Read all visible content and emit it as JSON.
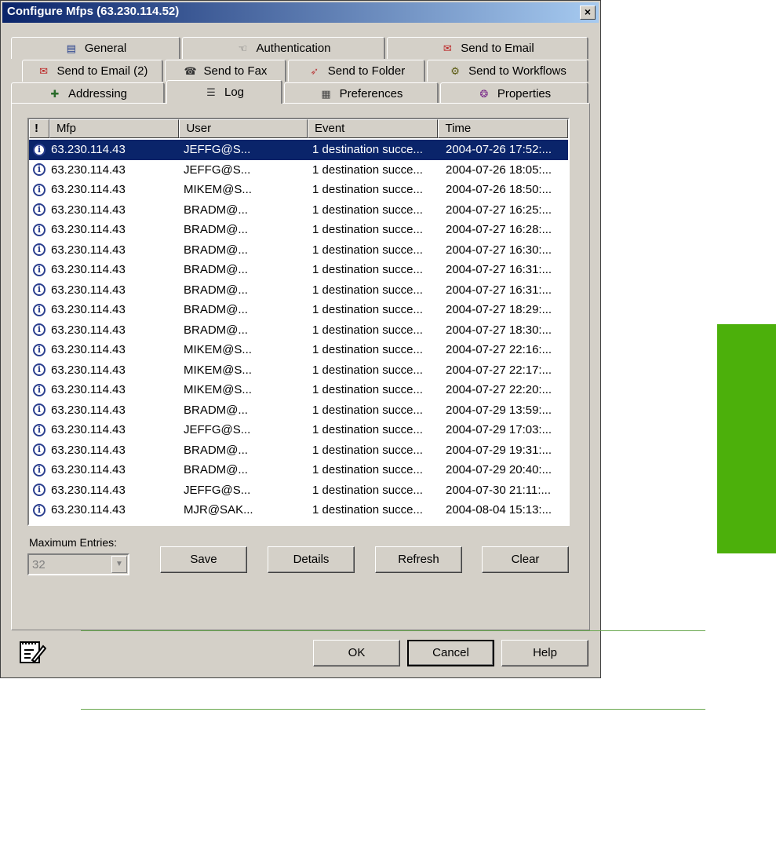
{
  "window": {
    "title": "Configure Mfps (63.230.114.52)",
    "close_label": "×"
  },
  "tabs": {
    "row1": [
      {
        "label": "General",
        "icon": "general-icon"
      },
      {
        "label": "Authentication",
        "icon": "authentication-icon"
      },
      {
        "label": "Send to Email",
        "icon": "send-email-icon"
      }
    ],
    "row2": [
      {
        "label": "Send to Email (2)",
        "icon": "send-email-2-icon"
      },
      {
        "label": "Send to Fax",
        "icon": "send-fax-icon"
      },
      {
        "label": "Send to Folder",
        "icon": "send-folder-icon"
      },
      {
        "label": "Send to Workflows",
        "icon": "send-workflows-icon"
      }
    ],
    "row3": [
      {
        "label": "Addressing",
        "icon": "addressing-icon"
      },
      {
        "label": "Log",
        "icon": "log-icon",
        "active": true
      },
      {
        "label": "Preferences",
        "icon": "preferences-icon"
      },
      {
        "label": "Properties",
        "icon": "properties-icon"
      }
    ]
  },
  "log": {
    "columns": [
      "!",
      "Mfp",
      "User",
      "Event",
      "Time"
    ],
    "rows": [
      {
        "mfp": "63.230.114.43",
        "user": "JEFFG@S...",
        "event": "1 destination succe...",
        "time": "2004-07-26 17:52:...",
        "selected": true
      },
      {
        "mfp": "63.230.114.43",
        "user": "JEFFG@S...",
        "event": "1 destination succe...",
        "time": "2004-07-26 18:05:..."
      },
      {
        "mfp": "63.230.114.43",
        "user": "MIKEM@S...",
        "event": "1 destination succe...",
        "time": "2004-07-26 18:50:..."
      },
      {
        "mfp": "63.230.114.43",
        "user": "BRADM@...",
        "event": "1 destination succe...",
        "time": "2004-07-27 16:25:..."
      },
      {
        "mfp": "63.230.114.43",
        "user": "BRADM@...",
        "event": "1 destination succe...",
        "time": "2004-07-27 16:28:..."
      },
      {
        "mfp": "63.230.114.43",
        "user": "BRADM@...",
        "event": "1 destination succe...",
        "time": "2004-07-27 16:30:..."
      },
      {
        "mfp": "63.230.114.43",
        "user": "BRADM@...",
        "event": "1 destination succe...",
        "time": "2004-07-27 16:31:..."
      },
      {
        "mfp": "63.230.114.43",
        "user": "BRADM@...",
        "event": "1 destination succe...",
        "time": "2004-07-27 16:31:..."
      },
      {
        "mfp": "63.230.114.43",
        "user": "BRADM@...",
        "event": "1 destination succe...",
        "time": "2004-07-27 18:29:..."
      },
      {
        "mfp": "63.230.114.43",
        "user": "BRADM@...",
        "event": "1 destination succe...",
        "time": "2004-07-27 18:30:..."
      },
      {
        "mfp": "63.230.114.43",
        "user": "MIKEM@S...",
        "event": "1 destination succe...",
        "time": "2004-07-27 22:16:..."
      },
      {
        "mfp": "63.230.114.43",
        "user": "MIKEM@S...",
        "event": "1 destination succe...",
        "time": "2004-07-27 22:17:..."
      },
      {
        "mfp": "63.230.114.43",
        "user": "MIKEM@S...",
        "event": "1 destination succe...",
        "time": "2004-07-27 22:20:..."
      },
      {
        "mfp": "63.230.114.43",
        "user": "BRADM@...",
        "event": "1 destination succe...",
        "time": "2004-07-29 13:59:..."
      },
      {
        "mfp": "63.230.114.43",
        "user": "JEFFG@S...",
        "event": "1 destination succe...",
        "time": "2004-07-29 17:03:..."
      },
      {
        "mfp": "63.230.114.43",
        "user": "BRADM@...",
        "event": "1 destination succe...",
        "time": "2004-07-29 19:31:..."
      },
      {
        "mfp": "63.230.114.43",
        "user": "BRADM@...",
        "event": "1 destination succe...",
        "time": "2004-07-29 20:40:..."
      },
      {
        "mfp": "63.230.114.43",
        "user": "JEFFG@S...",
        "event": "1 destination succe...",
        "time": "2004-07-30 21:11:..."
      },
      {
        "mfp": "63.230.114.43",
        "user": "MJR@SAK...",
        "event": "1 destination succe...",
        "time": "2004-08-04 15:13:..."
      }
    ],
    "max_entries_label": "Maximum Entries:",
    "max_entries_value": "32",
    "buttons": {
      "save": "Save",
      "details": "Details",
      "refresh": "Refresh",
      "clear": "Clear"
    }
  },
  "footer_buttons": {
    "ok": "OK",
    "cancel": "Cancel",
    "help": "Help"
  },
  "colors": {
    "dialog_bg": "#d4d0c8",
    "selection": "#0a246a",
    "page_accent": "#4cb00b",
    "rule": "#6aa84f"
  }
}
